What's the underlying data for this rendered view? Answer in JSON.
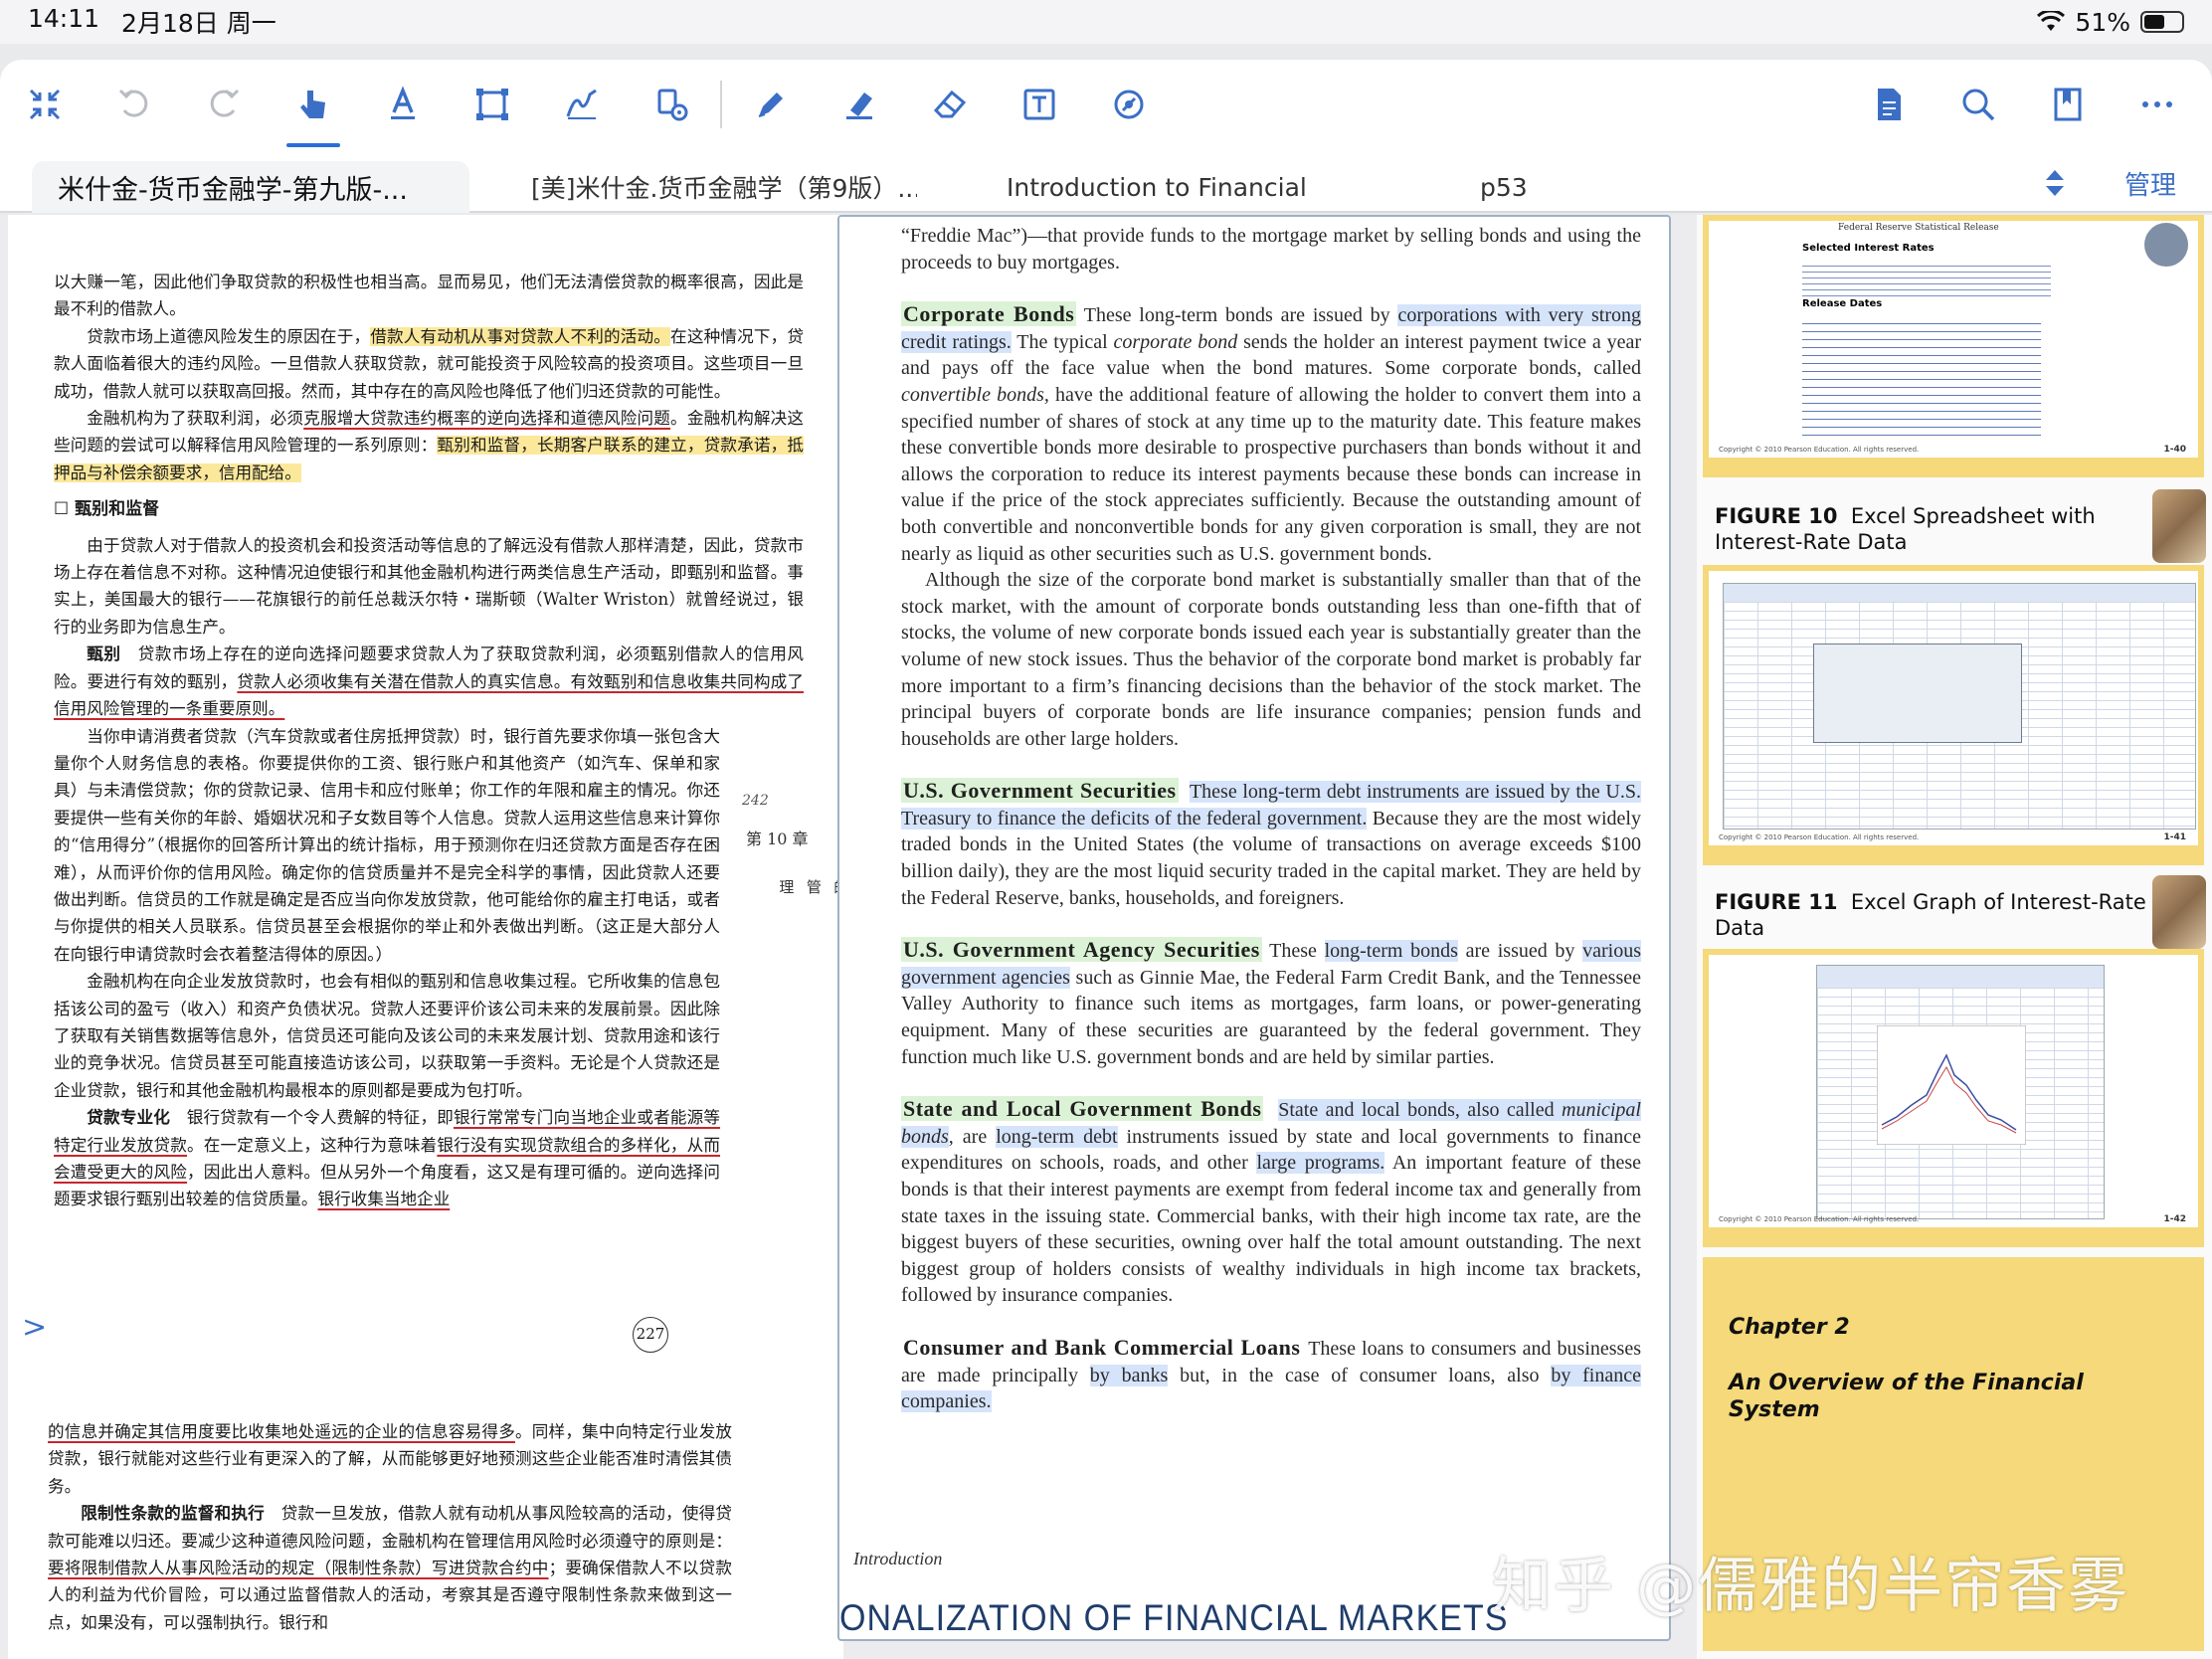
{
  "status": {
    "time": "14:11",
    "date": "2月18日 周一",
    "battery": "51%"
  },
  "toolbar": {
    "left_icons": [
      "collapse-icon",
      "undo-icon",
      "redo-icon",
      "hand-pointer-icon",
      "text-underline-icon",
      "select-rect-icon",
      "signature-icon",
      "stamp-settings-icon"
    ],
    "mid_icons": [
      "pen-icon",
      "highlighter-icon",
      "eraser-icon",
      "text-box-icon",
      "shape-settings-icon"
    ],
    "right_icons": [
      "document-icon",
      "search-icon",
      "bookmark-icon",
      "more-icon"
    ],
    "accent": "#2a6fd6"
  },
  "tabs": {
    "items": [
      {
        "label": "米什金-货币金融学-第九版-..."
      },
      {
        "label": "[美]米什金.货币金融学（第9版）..."
      },
      {
        "label": "Introduction to Financial"
      },
      {
        "label": "p53"
      }
    ],
    "manage": "管理"
  },
  "left_page": {
    "p1": "以大赚一笔，因此他们争取贷款的积极性也相当高。显而易见，他们无法清偿贷款的概率很高，因此是最不利的借款人。",
    "p2a": "贷款市场上道德风险发生的原因在于，",
    "p2b": "借款人有动机从事对贷款人不利的活动。",
    "p2c": "在这种情况下，贷款人面临着很大的违约风险。一旦借款人获取贷款，就可能投资于风险较高的投资项目。这些项目一旦成功，借款人就可以获取高回报。然而，其中存在的高风险也降低了他们归还贷款的可能性。",
    "p3a": "金融机构为了获取利润，必须",
    "p3b": "克服增大贷款违约概率的逆向选择和道德风险问题",
    "p3c": "。金融机构解决这些问题的尝试可以解释信用风险管理的一系列原则：",
    "p3d": "甄别和监督，长期客户联系的建立，贷款承诺，抵押品与补偿余额要求，信用配给。",
    "sec1": "☐ 甄别和监督",
    "p4": "由于贷款人对于借款人的投资机会和投资活动等信息的了解远没有借款人那样清楚，因此，贷款市场上存在着信息不对称。这种情况迫使银行和其他金融机构进行两类信息生产活动，即甄别和监督。事实上，美国最大的银行——花旗银行的前任总裁沃尔特・瑞斯顿（Walter Wriston）就曾经说过，银行的业务即为信息生产。",
    "p5a": "甄别",
    "p5b": "贷款市场上存在的逆向选择问题要求贷款人为了获取贷款利润，必须甄别借款人的信用风险。要进行有效的甄别，",
    "p5c": "贷款人必须收集有关潜在借款人的真实信息。有效甄别和信息收集共同构成了信用风险管理的一条重要原则。",
    "p6": "当你申请消费者贷款（汽车贷款或者住房抵押贷款）时，银行首先要求你填一张包含大量你个人财务信息的表格。你要提供你的工资、银行账户和其他资产（如汽车、保单和家具）与未清偿贷款；你的贷款记录、信用卡和应付账单；你工作的年限和雇主的情况。你还要提供一些有关你的年龄、婚姻状况和子女数目等个人信息。贷款人运用这些信息来计算你的“信用得分”（根据你的回答所计算出的统计指标，用于预测你在归还贷款方面是否存在困难），从而评价你的信用风险。确定你的信贷质量并不是完全科学的事情，因此贷款人还要做出判断。信贷员的工作就是确定是否应当向你发放贷款，他可能给你的雇主打电话，或者与你提供的相关人员联系。信贷员甚至会根据你的举止和外表做出判断。（这正是大部分人在向银行申请贷款时会衣着整洁得体的原因。）",
    "p7": "金融机构在向企业发放贷款时，也会有相似的甄别和信息收集过程。它所收集的信息包括该公司的盈亏（收入）和资产负债状况。贷款人还要评价该公司未来的发展前景。因此除了获取有关销售数据等信息外，信贷员还可能向及该公司的未来发展计划、贷款用途和该行业的竞争状况。信贷员甚至可能直接造访该公司，以获取第一手资料。无论是个人贷款还是企业贷款，银行和其他金融机构最根本的原则都是要成为包打听。",
    "p8a": "贷款专业化",
    "p8b": "银行贷款有一个令人费解的特征，即",
    "p8c": "银行常常专门向当地企业或者能源等特定行业发放贷款",
    "p8d": "。在一定意义上，这种行为意味着",
    "p8e": "银行没有实现贷款组合的多样化，从而会遭受更大的风险",
    "p8f": "，因此出人意料。但从另外一个角度看，这又是有理可循的。逆向选择问题要求银行甄别出较差的信贷质量。",
    "p8g": "银行收集当地企业",
    "chapter_no": "第 10 章",
    "chapter_title": "银行业与金融机构的管理",
    "margin_note": "242",
    "page_number": "227",
    "lower1a": "的信息并确定其信用度要比收集地处遥远的企业的信息容易得多",
    "lower1b": "。同样，集中向特定行业发放贷款，银行就能对这些行业有更深入的了解，从而能够更好地预测这些企业能否准时清偿其债务。",
    "lower2a": "限制性条款的监督和执行",
    "lower2b": "贷款一旦发放，借款人就有动机从事风险较高的活动，使得贷款可能难以归还。要减少这种道德风险问题，金融机构在管理信用风险时必须遵守的原则是：",
    "lower2c": "要将限制借款人从事风险活动的规定（限制性条款）写进贷款合约中",
    "lower2d": "；要确保借款人不以贷款人的利益为代价冒险，可以通过监督借款人的活动，考察其是否遵守限制性条款来做到这一点，如果没有，可以强制执行。银行和"
  },
  "mid_page": {
    "intro_a": "“Freddie Mac”)—that provide funds to the mortgage market by selling bonds and using the proceeds to buy mortgages.",
    "corp_head": "Corporate Bonds",
    "corp_a": " These long-term bonds are issued by ",
    "corp_b": "corporations with very strong credit ratings.",
    "corp_c": " The typical ",
    "corp_d": "corporate bond",
    "corp_e": " sends the holder an interest payment twice a year and pays off the face value when the bond matures. Some corporate bonds, called ",
    "corp_f": "convertible bonds,",
    "corp_g": " have the additional feature of allowing the holder to convert them into a specified number of shares of stock at any time up to the maturity date. This feature makes these convertible bonds more desirable to prospective purchasers than bonds without it and allows the corporation to reduce its interest payments because these bonds can increase in value if the price of the stock appreciates sufficiently. Because the outstanding amount of both convertible and nonconvertible bonds for any given corporation is small, they are not nearly as liquid as other securities such as U.S. government bonds.",
    "corp_p2": "Although the size of the corporate bond market is substantially smaller than that of the stock market, with the amount of corporate bonds outstanding less than one-fifth that of stocks, the volume of new corporate bonds issued each year is substantially greater than the volume of new stock issues. Thus the behavior of the corporate bond market is probably far more important to a firm’s financing decisions than the behavior of the stock market. The principal buyers of corporate bonds are life insurance companies; pension funds and households are other large holders.",
    "gov_head": "U.S. Government Securities",
    "gov_a": "These long-term debt instruments are issued by the U.S. Treasury to finance the deficits of the federal government.",
    "gov_b": " Because they are the most widely traded bonds in the United States (the volume of transactions on average exceeds $100 billion daily), they are the most liquid security traded in the capital market. They are held by the Federal Reserve, banks, households, and foreigners.",
    "agency_head": "U.S. Government Agency Securities",
    "agency_a": " These ",
    "agency_b": "long-term bonds",
    "agency_c": " are issued by ",
    "agency_d": "various government agencies",
    "agency_e": " such as Ginnie Mae, the Federal Farm Credit Bank, and the Tennessee Valley Authority to finance such items as mortgages, farm loans, or power-generating equipment. Many of these securities are guaranteed by the federal government. They function much like U.S. government bonds and are held by similar parties.",
    "state_head": "State and Local Government Bonds",
    "state_a": "State and local bonds, also called ",
    "state_b": "municipal bonds",
    "state_c": ", are ",
    "state_d": "long-term debt",
    "state_e": " instruments issued by state and local governments to finance expenditures on schools, roads, and other ",
    "state_f": "large programs.",
    "state_g": " An important feature of these bonds is that their interest payments are exempt from federal income tax and generally from state taxes in the issuing state. Commercial banks, with their high income tax rate, are the biggest buyers of these securities, owning over half the total amount outstanding. The next biggest group of holders consists of wealthy individuals in high income tax brackets, followed by insurance companies.",
    "cons_head": "Consumer and Bank Commercial Loans",
    "cons_a": " These loans to consumers and businesses are made principally ",
    "cons_b": "by banks",
    "cons_c": " but, in the case of consumer loans, also ",
    "cons_d": "by finance companies.",
    "footer": "Introduction",
    "bottom_strip": "ONALIZATION OF FINANCIAL MARKETS"
  },
  "right_panel": {
    "slide1_title": "Federal Reserve Statistical Release",
    "slide1_sub": "Selected Interest Rates",
    "slide1_release": "Release Dates",
    "slide1_page": "1-40",
    "fig10_num": "FIGURE 10",
    "fig10_title": "Excel Spreadsheet with Interest-Rate Data",
    "slide2_page": "1-41",
    "fig11_num": "FIGURE 11",
    "fig11_title": "Excel Graph of Interest-Rate Data",
    "slide3_page": "1-42",
    "copyright": "Copyright © 2010 Pearson Education. All rights reserved.",
    "chapter_label": "Chapter 2",
    "chapter_title": "An Overview of the Financial System",
    "slide_color": "#f5d97a"
  },
  "watermark": "知乎 @儒雅的半帘香雾"
}
